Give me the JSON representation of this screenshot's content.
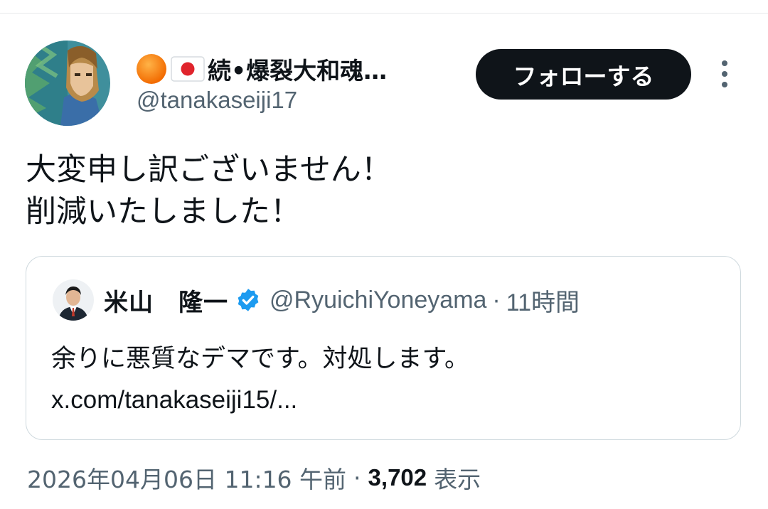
{
  "author": {
    "display_name": "続•爆裂大和魂…",
    "handle": "@tanakaseiji17",
    "name_icons": [
      "orange-circle-icon",
      "japan-flag-icon"
    ]
  },
  "follow_button": {
    "label": "フォローする"
  },
  "tweet": {
    "text": "大変申し訳ございません！\n削減いたしました！"
  },
  "quote": {
    "author_name": "米山　隆一",
    "verified": true,
    "handle": "@RyuichiYoneyama",
    "separator": "·",
    "time": "11時間",
    "text": "余りに悪質なデマです。対処します。",
    "link": "x.com/tanakaseiji15/..."
  },
  "meta": {
    "datetime": "2026年04月06日 11:16 午前",
    "separator": "·",
    "view_count": "3,702",
    "views_label": "表示"
  },
  "colors": {
    "text_primary": "#0f1419",
    "text_secondary": "#536471",
    "verified_blue": "#1d9bf0",
    "follow_button_bg": "#0f1419",
    "border": "#cfd9de"
  }
}
